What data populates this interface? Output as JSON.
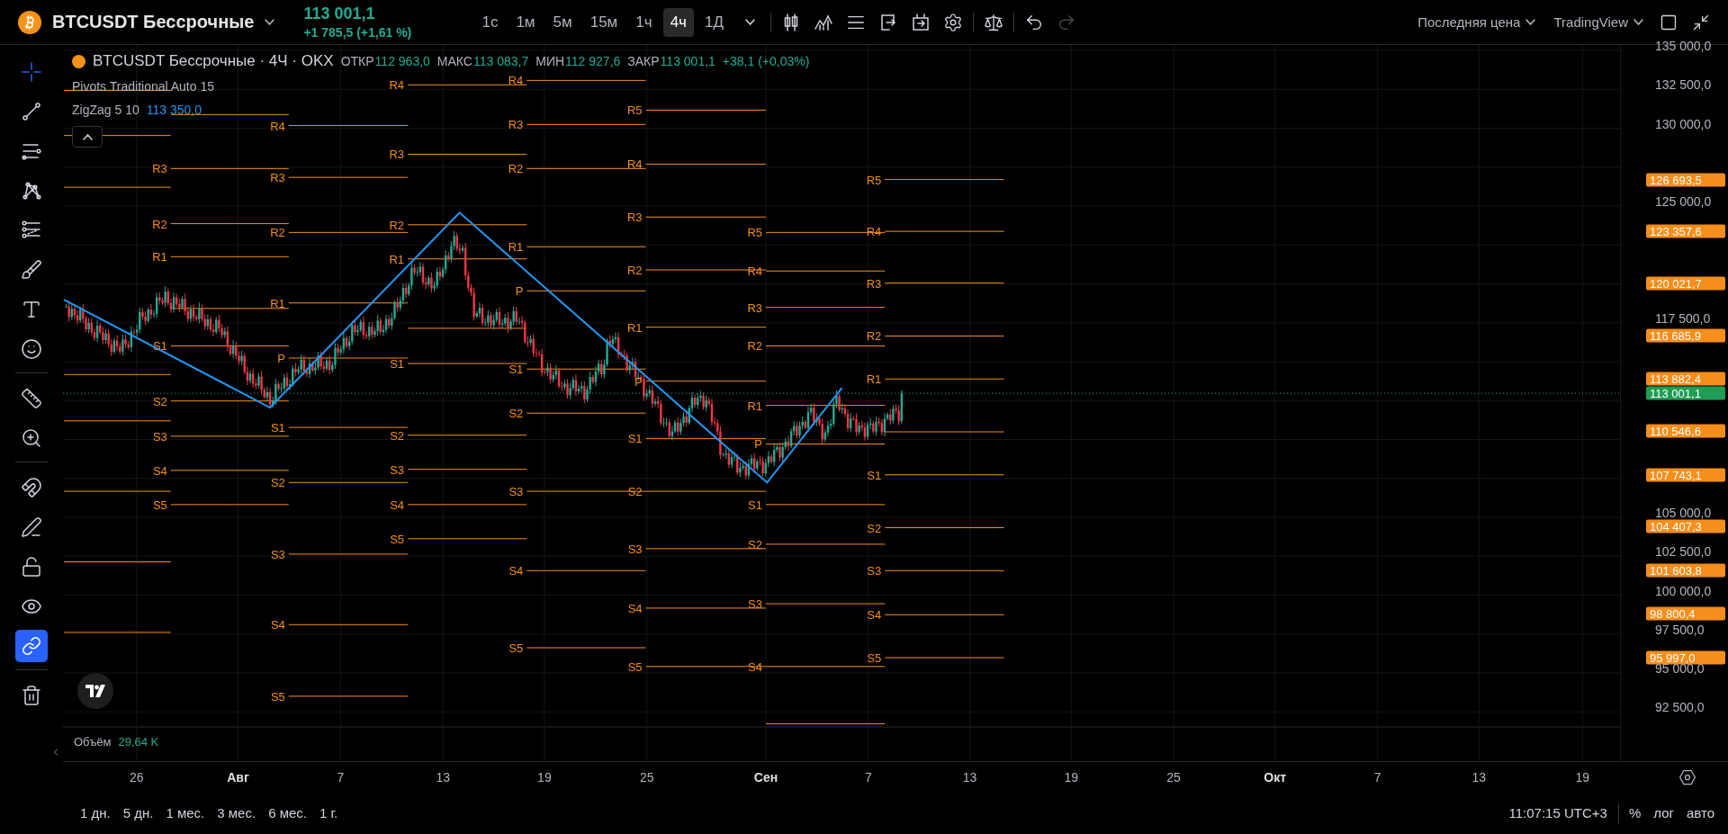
{
  "top_bar": {
    "symbol": "BTCUSDT Бессрочные",
    "price": "113 001,1",
    "change": "+1 785,5 (+1,61 %)",
    "intervals": [
      {
        "label": "1с",
        "selected": false
      },
      {
        "label": "1м",
        "selected": false
      },
      {
        "label": "5м",
        "selected": false
      },
      {
        "label": "15м",
        "selected": false
      },
      {
        "label": "1ч",
        "selected": false
      },
      {
        "label": "4ч",
        "selected": true
      },
      {
        "label": "1Д",
        "selected": false
      }
    ],
    "actions": [
      {
        "kind": "candles",
        "disabled": false
      },
      {
        "kind": "indicators",
        "disabled": false
      },
      {
        "kind": "templates",
        "disabled": false
      },
      {
        "kind": "alert",
        "disabled": false
      },
      {
        "kind": "replay",
        "disabled": false
      },
      {
        "kind": "settings",
        "disabled": false
      },
      {
        "kind": "scales",
        "disabled": false
      },
      {
        "kind": "undo",
        "disabled": false
      },
      {
        "kind": "redo",
        "disabled": true
      }
    ],
    "price_source": "Последняя цена",
    "chart_brand": "TradingView"
  },
  "left_toolbar": {
    "groups": [
      {
        "tools": [
          {
            "kind": "crosshair",
            "selected": true
          },
          {
            "kind": "trend-line",
            "selected": false
          },
          {
            "kind": "parallel-lines",
            "selected": false
          },
          {
            "kind": "pattern",
            "selected": false
          },
          {
            "kind": "fib",
            "selected": false
          },
          {
            "kind": "brush",
            "selected": false
          },
          {
            "kind": "text",
            "selected": false
          },
          {
            "kind": "emoji",
            "selected": false
          }
        ]
      },
      {
        "tools": [
          {
            "kind": "ruler",
            "selected": false
          },
          {
            "kind": "zoom",
            "selected": false
          }
        ]
      },
      {
        "tools": [
          {
            "kind": "magnet",
            "selected": false
          },
          {
            "kind": "lock-drawing",
            "selected": false
          },
          {
            "kind": "unlock",
            "selected": false
          },
          {
            "kind": "eye",
            "selected": false
          },
          {
            "kind": "link",
            "selected": true
          }
        ]
      },
      {
        "tools": [
          {
            "kind": "trash",
            "selected": false
          }
        ]
      }
    ]
  },
  "legend": {
    "title": "BTCUSDT Бессрочные · 4Ч · OKX",
    "ohlc": [
      {
        "label": "ОТКР",
        "value": "112 963,0"
      },
      {
        "label": "МАКС",
        "value": "113 083,7"
      },
      {
        "label": "МИН",
        "value": "112 927,6"
      },
      {
        "label": "ЗАКР",
        "value": "113 001,1"
      }
    ],
    "change": "+38,1 (+0,03%)",
    "indicators": [
      {
        "name": "Pivots Traditional Auto 15"
      },
      {
        "name": "ZigZag 5 10",
        "value": "113 350,0"
      }
    ]
  },
  "pivot_periods": [
    {
      "labels": [
        "R3",
        "R2",
        "R1",
        "S1",
        "S2",
        "S3",
        "S4",
        "S5"
      ]
    },
    {
      "labels": [
        "R4",
        "R3",
        "R2",
        "R1",
        "P",
        "S1",
        "S2",
        "S3",
        "S4",
        "S5"
      ]
    },
    {
      "labels": [
        "R4",
        "R3",
        "R2",
        "R1",
        "S1",
        "S2",
        "S3",
        "S4",
        "S5"
      ]
    },
    {
      "labels": [
        "R4",
        "R3",
        "R2",
        "R1",
        "P",
        "S1",
        "S2",
        "S3",
        "S4",
        "S5"
      ]
    },
    {
      "labels": [
        "R5",
        "R4",
        "R3",
        "R2",
        "R1",
        "P",
        "S1",
        "S2",
        "S3",
        "S4",
        "S5"
      ]
    },
    {
      "labels": [
        "R5",
        "R4",
        "R3",
        "R2",
        "R1",
        "P",
        "S1",
        "S2",
        "S3",
        "S4"
      ]
    },
    {
      "labels": [
        "R5",
        "R4",
        "R3",
        "R2",
        "R1",
        "S1",
        "S2",
        "S3",
        "S4",
        "S5"
      ]
    }
  ],
  "price_axis": {
    "ticks": [
      "135 000,0",
      "132 500,0",
      "130 000,0",
      "125 000,0",
      "117 500,0",
      "105 000,0",
      "102 500,0",
      "100 000,0",
      "97 500,0",
      "95 000,0",
      "92 500,0"
    ],
    "tags": [
      {
        "text": "126 693,5",
        "kind": "pivot"
      },
      {
        "text": "123 357,6",
        "kind": "pivot"
      },
      {
        "text": "120 021,7",
        "kind": "pivot"
      },
      {
        "text": "116 685,9",
        "kind": "pivot"
      },
      {
        "text": "113 882,4",
        "kind": "pivot"
      },
      {
        "text": "113 001,1",
        "kind": "last"
      },
      {
        "text": "110 546,6",
        "kind": "pivot"
      },
      {
        "text": "107 743,1",
        "kind": "pivot"
      },
      {
        "text": "104 407,3",
        "kind": "pivot"
      },
      {
        "text": "101 603,8",
        "kind": "pivot"
      },
      {
        "text": "98 800,4",
        "kind": "pivot"
      },
      {
        "text": "95 997,0",
        "kind": "pivot"
      }
    ]
  },
  "volume": {
    "label": "Объём",
    "value": "29,64 K"
  },
  "time_axis": {
    "ticks": [
      {
        "label": "26",
        "kind": "day"
      },
      {
        "label": "Авг",
        "kind": "month"
      },
      {
        "label": "7",
        "kind": "day"
      },
      {
        "label": "13",
        "kind": "day"
      },
      {
        "label": "19",
        "kind": "day"
      },
      {
        "label": "25",
        "kind": "day"
      },
      {
        "label": "Сен",
        "kind": "month"
      },
      {
        "label": "7",
        "kind": "day"
      },
      {
        "label": "13",
        "kind": "day"
      },
      {
        "label": "19",
        "kind": "day"
      },
      {
        "label": "25",
        "kind": "day"
      },
      {
        "label": "Окт",
        "kind": "month"
      },
      {
        "label": "7",
        "kind": "day"
      },
      {
        "label": "13",
        "kind": "day"
      },
      {
        "label": "19",
        "kind": "day"
      }
    ]
  },
  "bottom_bar": {
    "ranges": [
      "1 дн.",
      "5 дн.",
      "1 мес.",
      "3 мес.",
      "6 мес.",
      "1 г."
    ],
    "clock": "11:07:15 UTC+3",
    "scale_options": [
      "%",
      "лог",
      "авто"
    ]
  }
}
